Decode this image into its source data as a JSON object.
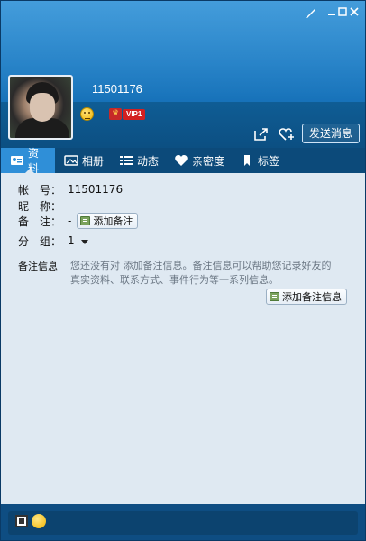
{
  "window": {
    "controls": {
      "skin": "skin-icon",
      "min": "minimize-icon",
      "max": "maximize-icon",
      "close": "close-icon"
    }
  },
  "profile": {
    "user_id": "11501176",
    "vip_label": "VIP1",
    "send_message": "发送消息"
  },
  "tabs": [
    {
      "label": "资料",
      "icon": "profile-card-icon"
    },
    {
      "label": "相册",
      "icon": "album-icon"
    },
    {
      "label": "动态",
      "icon": "feed-icon"
    },
    {
      "label": "亲密度",
      "icon": "heart-icon"
    },
    {
      "label": "标签",
      "icon": "bookmark-icon"
    }
  ],
  "info": {
    "account_label": "帐　号：",
    "account_value": "11501176",
    "nickname_label": "昵　称：",
    "nickname_value": "",
    "note_label": "备　注：",
    "note_value": "-",
    "add_note": "添加备注",
    "group_label": "分　组：",
    "group_value": "1"
  },
  "remark": {
    "label": "备注信息",
    "text": "您还没有对 添加备注信息。备注信息可以帮助您记录好友的真实资料、联系方式、事件行为等一系列信息。",
    "add_button": "添加备注信息"
  },
  "colors": {
    "header": "#1f7fc7",
    "tab_active": "#2f8fd8",
    "content_bg": "#dfe9f2",
    "vip_red": "#d32020"
  }
}
